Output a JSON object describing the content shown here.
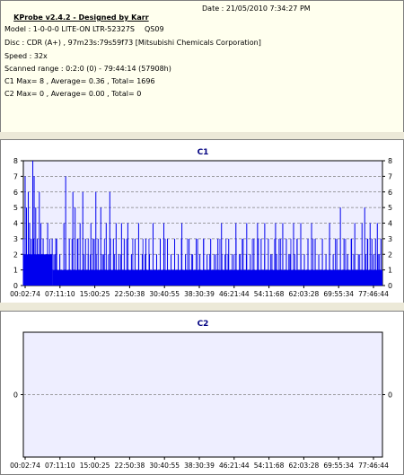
{
  "info": {
    "app_title": "KProbe v2.4.2 - Designed by Karr",
    "date": "Date : 21/05/2010 7:34:27 PM",
    "model": "Model : 1-0-0-0 LITE-ON LTR-52327S",
    "firmware": "QS09",
    "disc": "Disc : CDR (A+) , 97m23s:79s59f73 [Mitsubishi Chemicals Corporation]",
    "speed": "Speed : 32x",
    "scanned_range": "Scanned range : 0:2:0 (0) - 79:44:14 (57908h)",
    "c1_summary": "C1 Max= 8 , Average= 0.36 , Total= 1696",
    "c2_summary": "C2 Max= 0 , Average= 0.00 , Total= 0"
  },
  "colors": {
    "bar": "#0000ee",
    "axis": "#000000",
    "grid": "#808080",
    "title": "#000080",
    "plot_bg": "#eeeeff",
    "panel_bg": "#ffffee"
  },
  "chart_data": [
    {
      "type": "bar",
      "title": "C1",
      "ylim": [
        0,
        8
      ],
      "yticks": [
        "0",
        "1",
        "2",
        "3",
        "4",
        "5",
        "6",
        "7",
        "8"
      ],
      "xticks": [
        "00:02:74",
        "07:11:10",
        "15:00:25",
        "22:50:38",
        "30:40:55",
        "38:30:39",
        "46:21:44",
        "54:11:68",
        "62:03:28",
        "69:55:34",
        "77:46:44"
      ],
      "grid": "horizontal dashed",
      "max": 8,
      "average": 0.36,
      "total": 1696,
      "spikes": [
        {
          "x": 0.0,
          "v": 3
        },
        {
          "x": 0.4,
          "v": 7
        },
        {
          "x": 0.7,
          "v": 5
        },
        {
          "x": 1.1,
          "v": 6
        },
        {
          "x": 1.4,
          "v": 4
        },
        {
          "x": 1.75,
          "v": 3
        },
        {
          "x": 2.1,
          "v": 8
        },
        {
          "x": 2.4,
          "v": 7
        },
        {
          "x": 2.75,
          "v": 5
        },
        {
          "x": 3.1,
          "v": 3
        },
        {
          "x": 3.55,
          "v": 6
        },
        {
          "x": 3.9,
          "v": 4
        },
        {
          "x": 4.4,
          "v": 3
        },
        {
          "x": 5.0,
          "v": 2
        },
        {
          "x": 5.4,
          "v": 4
        },
        {
          "x": 6.0,
          "v": 2
        },
        {
          "x": 6.4,
          "v": 3
        },
        {
          "x": 7.0,
          "v": 2
        },
        {
          "x": 7.4,
          "v": 3
        },
        {
          "x": 8.1,
          "v": 2
        },
        {
          "x": 9.0,
          "v": 4
        },
        {
          "x": 9.4,
          "v": 7
        },
        {
          "x": 10.2,
          "v": 3
        },
        {
          "x": 11.0,
          "v": 6
        },
        {
          "x": 11.5,
          "v": 5
        },
        {
          "x": 12.0,
          "v": 3
        },
        {
          "x": 12.6,
          "v": 4
        },
        {
          "x": 13.2,
          "v": 6
        },
        {
          "x": 13.8,
          "v": 3
        },
        {
          "x": 14.4,
          "v": 2
        },
        {
          "x": 15.0,
          "v": 4
        },
        {
          "x": 15.5,
          "v": 3
        },
        {
          "x": 16.1,
          "v": 6
        },
        {
          "x": 16.6,
          "v": 3
        },
        {
          "x": 17.2,
          "v": 5
        },
        {
          "x": 17.8,
          "v": 2
        },
        {
          "x": 18.4,
          "v": 4
        },
        {
          "x": 19.2,
          "v": 6
        },
        {
          "x": 20.0,
          "v": 3
        },
        {
          "x": 20.6,
          "v": 4
        },
        {
          "x": 21.2,
          "v": 2
        },
        {
          "x": 21.8,
          "v": 4
        },
        {
          "x": 22.4,
          "v": 3
        },
        {
          "x": 23.2,
          "v": 4
        },
        {
          "x": 24.0,
          "v": 2
        },
        {
          "x": 24.8,
          "v": 3
        },
        {
          "x": 25.6,
          "v": 4
        },
        {
          "x": 26.4,
          "v": 2
        },
        {
          "x": 27.2,
          "v": 3
        },
        {
          "x": 28.0,
          "v": 2
        },
        {
          "x": 28.8,
          "v": 4
        },
        {
          "x": 29.6,
          "v": 2
        },
        {
          "x": 30.4,
          "v": 3
        },
        {
          "x": 31.2,
          "v": 4
        },
        {
          "x": 32.0,
          "v": 3
        },
        {
          "x": 32.8,
          "v": 2
        },
        {
          "x": 33.6,
          "v": 3
        },
        {
          "x": 34.4,
          "v": 2
        },
        {
          "x": 35.2,
          "v": 4
        },
        {
          "x": 36.0,
          "v": 2
        },
        {
          "x": 36.8,
          "v": 3
        },
        {
          "x": 37.6,
          "v": 2
        },
        {
          "x": 38.4,
          "v": 3
        },
        {
          "x": 39.2,
          "v": 2
        },
        {
          "x": 40.0,
          "v": 3
        },
        {
          "x": 40.8,
          "v": 2
        },
        {
          "x": 41.6,
          "v": 3
        },
        {
          "x": 42.4,
          "v": 2
        },
        {
          "x": 43.2,
          "v": 3
        },
        {
          "x": 44.0,
          "v": 4
        },
        {
          "x": 44.8,
          "v": 2
        },
        {
          "x": 45.6,
          "v": 3
        },
        {
          "x": 46.4,
          "v": 2
        },
        {
          "x": 47.2,
          "v": 4
        },
        {
          "x": 48.0,
          "v": 2
        },
        {
          "x": 48.8,
          "v": 3
        },
        {
          "x": 49.6,
          "v": 4
        },
        {
          "x": 50.4,
          "v": 2
        },
        {
          "x": 51.2,
          "v": 3
        },
        {
          "x": 52.0,
          "v": 4
        },
        {
          "x": 52.8,
          "v": 3
        },
        {
          "x": 53.6,
          "v": 4
        },
        {
          "x": 54.4,
          "v": 3
        },
        {
          "x": 55.2,
          "v": 2
        },
        {
          "x": 56.0,
          "v": 4
        },
        {
          "x": 56.8,
          "v": 3
        },
        {
          "x": 57.6,
          "v": 4
        },
        {
          "x": 58.4,
          "v": 3
        },
        {
          "x": 59.2,
          "v": 2
        },
        {
          "x": 60.0,
          "v": 4
        },
        {
          "x": 60.8,
          "v": 3
        },
        {
          "x": 61.6,
          "v": 4
        },
        {
          "x": 62.4,
          "v": 2
        },
        {
          "x": 63.2,
          "v": 3
        },
        {
          "x": 64.0,
          "v": 4
        },
        {
          "x": 64.8,
          "v": 3
        },
        {
          "x": 65.6,
          "v": 2
        },
        {
          "x": 66.4,
          "v": 3
        },
        {
          "x": 67.2,
          "v": 2
        },
        {
          "x": 68.0,
          "v": 4
        },
        {
          "x": 68.8,
          "v": 2
        },
        {
          "x": 69.6,
          "v": 3
        },
        {
          "x": 70.4,
          "v": 5
        },
        {
          "x": 71.2,
          "v": 3
        },
        {
          "x": 72.0,
          "v": 2
        },
        {
          "x": 72.8,
          "v": 3
        },
        {
          "x": 73.6,
          "v": 4
        },
        {
          "x": 74.4,
          "v": 2
        },
        {
          "x": 75.2,
          "v": 4
        },
        {
          "x": 75.8,
          "v": 5
        },
        {
          "x": 76.4,
          "v": 3
        },
        {
          "x": 77.0,
          "v": 4
        },
        {
          "x": 77.4,
          "v": 3
        },
        {
          "x": 77.8,
          "v": 2
        },
        {
          "x": 78.2,
          "v": 3
        },
        {
          "x": 78.6,
          "v": 4
        },
        {
          "x": 79.0,
          "v": 2
        },
        {
          "x": 79.4,
          "v": 3
        }
      ],
      "baseline": [
        {
          "from": 0.0,
          "to": 6.5,
          "v": 2
        },
        {
          "from": 6.5,
          "to": 18.0,
          "v": 1
        },
        {
          "from": 18.0,
          "to": 40.0,
          "v": 1
        },
        {
          "from": 40.0,
          "to": 52.0,
          "v": 1
        },
        {
          "from": 52.0,
          "to": 64.0,
          "v": 1
        },
        {
          "from": 64.0,
          "to": 79.7,
          "v": 1
        }
      ],
      "x_range_minutes": [
        0.0,
        79.74
      ]
    },
    {
      "type": "bar",
      "title": "C2",
      "ylim": [
        -1,
        1
      ],
      "yticks": [
        "0"
      ],
      "xticks": [
        "00:02:74",
        "07:11:10",
        "15:00:25",
        "22:50:38",
        "30:40:55",
        "38:30:39",
        "46:21:44",
        "54:11:68",
        "62:03:28",
        "69:55:34",
        "77:46:44"
      ],
      "grid": "horizontal dashed",
      "max": 0,
      "average": 0.0,
      "total": 0,
      "spikes": [],
      "baseline": [],
      "x_range_minutes": [
        0.0,
        79.74
      ]
    }
  ]
}
